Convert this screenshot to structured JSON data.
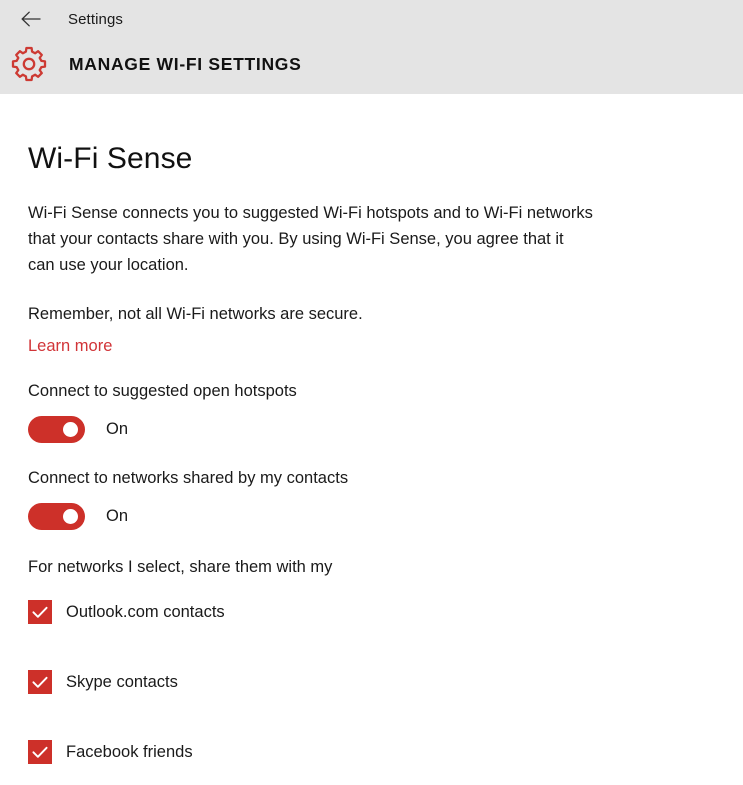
{
  "header": {
    "back_icon": "back-arrow-icon",
    "titlebar_label": "Settings",
    "gear_icon": "gear-icon",
    "page_heading": "MANAGE WI-FI SETTINGS",
    "background_color": "#e4e4e4"
  },
  "main": {
    "section_title": "Wi-Fi Sense",
    "description": "Wi-Fi Sense connects you to suggested Wi-Fi hotspots and to Wi-Fi networks that your contacts share with you. By using Wi-Fi Sense, you agree that it can use your location.",
    "security_note": "Remember, not all Wi-Fi networks are secure.",
    "learn_more_link": "Learn more",
    "link_color": "#d13438",
    "accent_color": "#cd3029",
    "toggles": [
      {
        "label": "Connect to suggested open hotspots",
        "state": "On",
        "checked": true
      },
      {
        "label": "Connect to networks shared by my contacts",
        "state": "On",
        "checked": true
      }
    ],
    "checkbox_group": {
      "label": "For networks I select, share them with my",
      "items": [
        {
          "label": "Outlook.com contacts",
          "checked": true
        },
        {
          "label": "Skype contacts",
          "checked": true
        },
        {
          "label": "Facebook friends",
          "checked": true
        }
      ]
    }
  }
}
